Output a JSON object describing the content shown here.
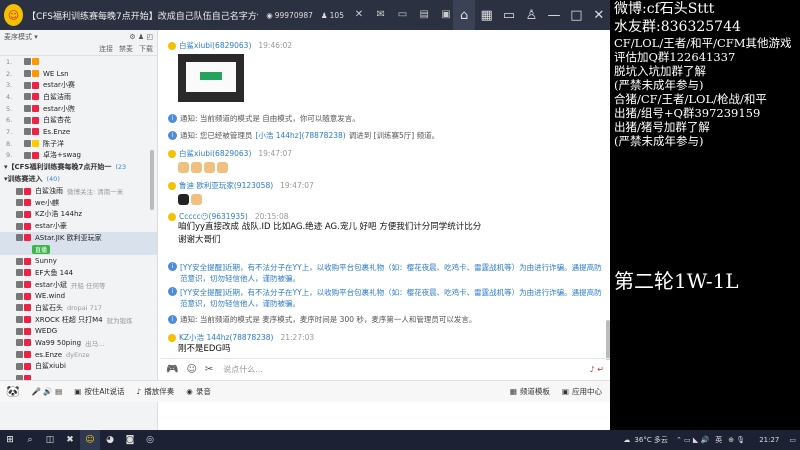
{
  "titlebar": {
    "channel_title": "【CFS福利训练赛每晚7点开始】改成自己队伍自己名字方便...",
    "viewers": "99970987",
    "online": "105",
    "nav": [
      "home-icon",
      "grid-icon",
      "monitor-icon",
      "user-icon",
      "minimize-icon",
      "maximize-icon",
      "close-icon"
    ]
  },
  "left": {
    "mode": "麦序模式 ▾",
    "tabs": [
      "连接",
      "禁麦",
      "下载"
    ],
    "users": [
      {
        "num": "1.",
        "name": "",
        "ex": "",
        "b": "o"
      },
      {
        "num": "2.",
        "name": "WE Lsn",
        "ex": "",
        "b": "o"
      },
      {
        "num": "3.",
        "name": "estar小赛",
        "ex": "",
        "b": "r"
      },
      {
        "num": "4.",
        "name": "白鲨洁雨",
        "ex": "",
        "b": "r"
      },
      {
        "num": "5.",
        "name": "estar小煦",
        "ex": "",
        "b": "r"
      },
      {
        "num": "6.",
        "name": "白鲨杏花",
        "ex": "",
        "b": "r"
      },
      {
        "num": "7.",
        "name": "Es.Enze",
        "ex": "",
        "b": "r"
      },
      {
        "num": "8.",
        "name": "陈子洋",
        "ex": "",
        "b": "y"
      },
      {
        "num": "9.",
        "name": "卓洛+swag",
        "ex": "",
        "b": "r"
      }
    ],
    "group1": "【CFS福利训练赛每晚7点开始一",
    "group1_count": "(23",
    "group2": "训练赛进入",
    "group2_count": "(40)",
    "members": [
      {
        "name": "白鲨浊雨",
        "ex": "微博关注: 清南一米",
        "b": "r"
      },
      {
        "name": "we小麒",
        "ex": "",
        "b": "r"
      },
      {
        "name": "KZ小浩 144hz",
        "ex": "",
        "b": "r"
      },
      {
        "name": "estar小豪",
        "ex": "",
        "b": "r"
      },
      {
        "name": "AStar.JIK 欧利亚玩家",
        "ex": "",
        "b": "r",
        "tag": "直播"
      },
      {
        "name": "Sunny",
        "ex": "",
        "b": "r"
      },
      {
        "name": "EF大鱼 144",
        "ex": "",
        "b": "r"
      },
      {
        "name": "estar小斌",
        "ex": "开船 任何等",
        "b": "r"
      },
      {
        "name": "WE.wind",
        "ex": "",
        "b": "r"
      },
      {
        "name": "白鲨石头",
        "ex": "dropai 717",
        "b": "r"
      },
      {
        "name": "XROCK 枉超 只打M4",
        "ex": "就为锻炼",
        "b": "r"
      },
      {
        "name": "WEDG",
        "ex": "",
        "b": "r"
      },
      {
        "name": "Wa99 50ping",
        "ex": "出马...",
        "b": "r"
      },
      {
        "name": "es.Enze",
        "ex": "dyEnze",
        "b": "r"
      },
      {
        "name": "白鲨xiubi",
        "ex": "",
        "b": "r"
      },
      {
        "name": "",
        "ex": "",
        "b": "r"
      }
    ]
  },
  "chat": {
    "m1_who": "白鲨xiubi(6829063)",
    "m1_time": "19:46:02",
    "n1": "通知: 当前频道的模式是 自由模式，你可以随意发言。",
    "n2_pre": "通知: 您已经被管理员",
    "n2_link": "[小浩 144hz](78878238)",
    "n2_post": "调进到 [训练赛5厅] 频道。",
    "m2_who": "白鲨xiubi(6829063)",
    "m2_time": "19:47:07",
    "m3_who": "鲁迪 欧利亚玩家(9123058)",
    "m3_time": "19:47:07",
    "m4_who": "Ccccc😶(9631935)",
    "m4_time": "20:15:08",
    "m4_text1": "咱们yy直接改成    战队.ID      比如AG.绝迹     AG.宠儿    好吧    方便我们计分同学统计比分",
    "m4_text2": "谢谢大哥们",
    "w1": "[YY安全提醒]近期，有不法分子在YY上，以收购平台包裹礼物（如：樱花夜晨、吃鸡卡、雷霆战机等）为由进行诈骗。遇提高防范意识，切勿轻信他人，谨防被骗。",
    "w2": "[YY安全提醒]近期，有不法分子在YY上，以收购平台包裹礼物（如：樱花夜晨、吃鸡卡、雷霆战机等）为由进行诈骗。遇提高防范意识，切勿轻信他人，谨防被骗。",
    "n3": "通知: 当前频道的模式是 麦序模式，麦序时间是 300 秒，麦序第一人和管理员可以发言。",
    "m5_who": "KZ小浩 144hz(78878238)",
    "m5_time": "21:27:03",
    "m5_text": "刚不是EDG吗",
    "placeholder": "说点什么..."
  },
  "bottom": {
    "hold_talk": "按住Alt说话",
    "play_music": "播放伴奏",
    "record": "录音",
    "channel_template": "频道模板",
    "app_center": "应用中心"
  },
  "taskbar": {
    "temp": "36°C 多云",
    "lang": "英",
    "clock": "21:27"
  },
  "overlay": {
    "lines": [
      "微博:cf石头Sttt",
      "水友群:836325744",
      "CF/LOL/王者/和平/CFM其他游戏",
      "评估加Q群122641337",
      "脱坑入坑加群了解",
      "(严禁未成年参与)",
      "合猪/CF/王者/LOL/枪战/和平",
      "出猪/组号+Q群397239159",
      "出猪/猪号加群了解",
      "(严禁未成年参与)"
    ],
    "round": "第二轮1W-1L"
  },
  "colors": {
    "titlebar": "#2c3142",
    "accent": "#2a7bd0",
    "overlay_bg": "#000000"
  }
}
